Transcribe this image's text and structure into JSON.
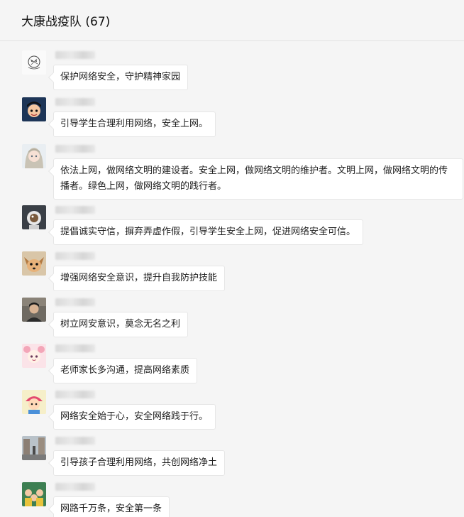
{
  "window": {
    "title": "大康战疫队 (67)"
  },
  "messages": [
    {
      "avatar_icon": "line-drawing-avatar-icon",
      "text": "保护网络安全，守护精神家园"
    },
    {
      "avatar_icon": "cartoon-boy-avatar-icon",
      "text": "引导学生合理利用网络，安全上网。"
    },
    {
      "avatar_icon": "anime-girl-avatar-icon",
      "text": "依法上网，做网络文明的建设者。安全上网，做网络文明的维护者。文明上网，做网络文明的传播者。绿色上网，做网络文明的践行者。"
    },
    {
      "avatar_icon": "astronaut-avatar-icon",
      "text": "提倡诚实守信，摒弃弄虚作假，引导学生安全上网，促进网络安全可信。"
    },
    {
      "avatar_icon": "puppy-avatar-icon",
      "text": "增强网络安全意识，提升自我防护技能"
    },
    {
      "avatar_icon": "person-photo-avatar-icon",
      "text": "树立网安意识，莫念无名之利"
    },
    {
      "avatar_icon": "cartoon-character-avatar-icon",
      "text": "老师家长多沟通，提高网络素质"
    },
    {
      "avatar_icon": "cartoon-kid-avatar-icon",
      "text": "网络安全始于心，安全网络践于行。"
    },
    {
      "avatar_icon": "street-photo-avatar-icon",
      "text": "引导孩子合理利用网络，共创网络净土"
    },
    {
      "avatar_icon": "group-photo-avatar-icon",
      "text": "网路千万条，安全第一条"
    }
  ]
}
